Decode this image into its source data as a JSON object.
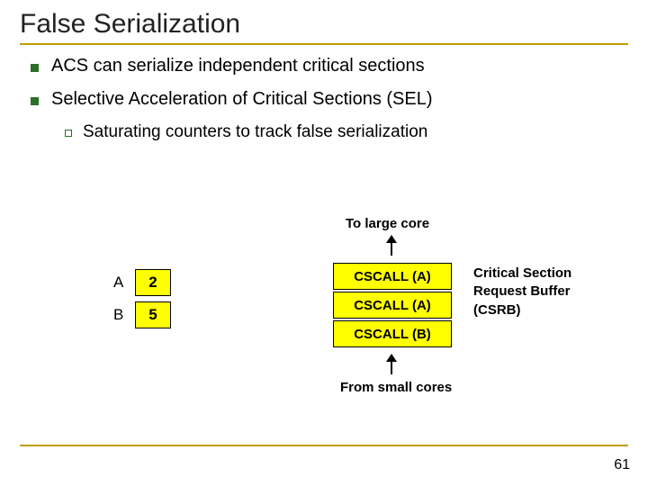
{
  "title": "False Serialization",
  "bullets": {
    "b1": "ACS can serialize independent critical sections",
    "b2": "Selective Acceleration of Critical Sections (SEL)",
    "b2_sub": "Saturating counters to track false serialization"
  },
  "diagram": {
    "to_large": "To large core",
    "from_small": "From small cores",
    "counters": [
      {
        "label": "A",
        "value": "2"
      },
      {
        "label": "B",
        "value": "5"
      }
    ],
    "buffer": [
      "CSCALL (A)",
      "CSCALL (A)",
      "CSCALL (B)"
    ],
    "csrb_label_l1": "Critical Section",
    "csrb_label_l2": "Request Buffer",
    "csrb_label_l3": "(CSRB)"
  },
  "page_number": "61"
}
